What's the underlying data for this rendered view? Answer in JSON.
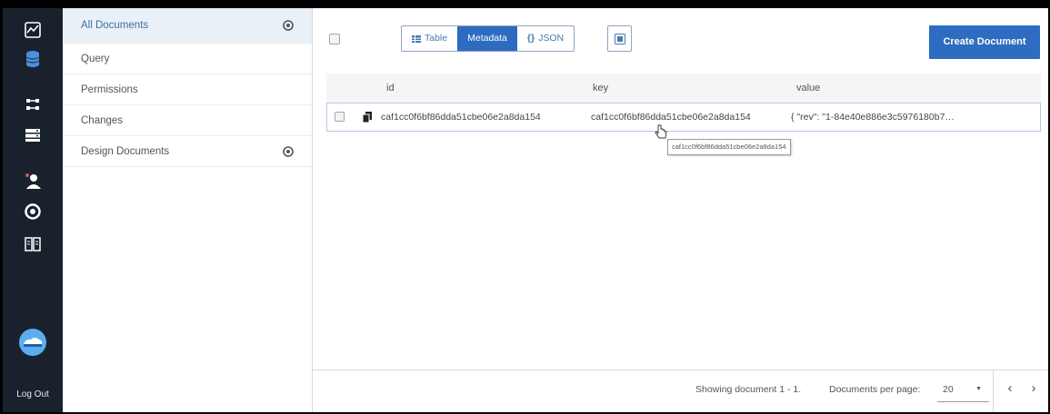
{
  "rail": {
    "items": [
      {
        "icon": "monitoring-chart-icon"
      },
      {
        "icon": "database-icon"
      },
      {
        "icon": "replication-icon"
      },
      {
        "icon": "active-tasks-icon"
      },
      {
        "icon": "user-account-icon"
      },
      {
        "icon": "support-icon"
      },
      {
        "icon": "documentation-icon"
      }
    ],
    "logo_icon": "cloudant-logo-icon",
    "logout_label": "Log Out"
  },
  "sidebar": {
    "items": [
      {
        "label": "All Documents",
        "has_add": true,
        "active": true
      },
      {
        "label": "Query",
        "has_add": false
      },
      {
        "label": "Permissions",
        "has_add": false
      },
      {
        "label": "Changes",
        "has_add": false
      },
      {
        "label": "Design Documents",
        "has_add": true
      }
    ]
  },
  "toolbar": {
    "views": [
      {
        "label": "Table",
        "icon": "table-icon",
        "active": false
      },
      {
        "label": "Metadata",
        "icon": "",
        "active": true
      },
      {
        "label": "JSON",
        "icon": "{}",
        "active": false
      }
    ],
    "create_label": "Create Document",
    "accent": "#2d6cc0"
  },
  "table": {
    "columns": [
      "id",
      "key",
      "value"
    ],
    "rows": [
      {
        "id": "caf1cc0f6bf86dda51cbe06e2a8da154",
        "key": "caf1cc0f6bf86dda51cbe06e2a8da154",
        "value": "{ \"rev\": \"1-84e40e886e3c5976180b7…"
      }
    ],
    "tooltip": "caf1cc0f6bf86dda51cbe06e2a8da154"
  },
  "footer": {
    "showing": "Showing document 1 - 1.",
    "per_page_label": "Documents per page:",
    "per_page_value": "20",
    "prev": "‹",
    "next": "›"
  }
}
